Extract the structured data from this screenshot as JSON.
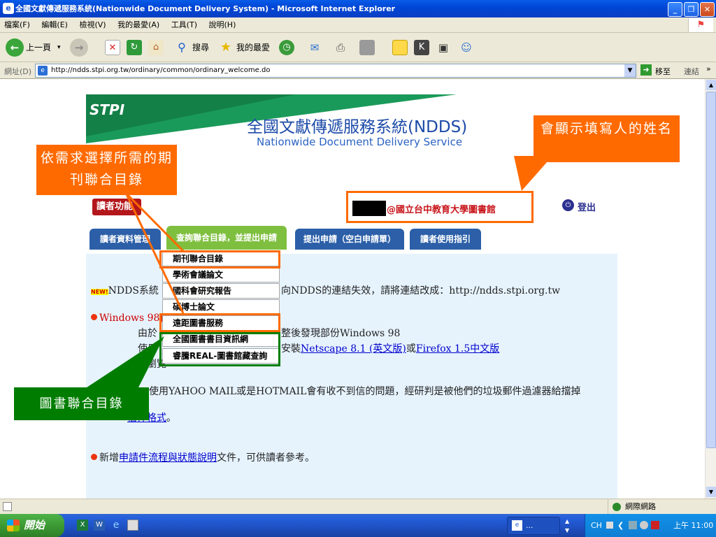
{
  "window": {
    "title": "全國文獻傳遞服務系統(Nationwide Document Delivery System) - Microsoft Internet Explorer"
  },
  "menubar": [
    "檔案(F)",
    "編輯(E)",
    "檢視(V)",
    "我的最愛(A)",
    "工具(T)",
    "說明(H)"
  ],
  "toolbar": {
    "back": "上一頁",
    "search": "搜尋",
    "favorites": "我的最愛"
  },
  "address": {
    "label": "網址(D)",
    "url": "http://ndds.stpi.org.tw/ordinary/common/ordinary_welcome.do",
    "go": "移至",
    "links": "連結"
  },
  "banner": {
    "logo": "STPI",
    "title_zh": "全國文獻傳遞服務系統(NDDS)",
    "title_en": "Nationwide Document Delivery Service"
  },
  "reader_func": "讀者功能",
  "user": {
    "org": "@國立台中教育大學圖書館"
  },
  "logout": "登出",
  "tabs": [
    "讀者資料管理",
    "查詢聯合目錄，並提出申請",
    "提出申請（空白申請單）",
    "讀者使用指引"
  ],
  "dropdown": [
    "期刊聯合目錄",
    "學術會議論文",
    "國科會研究報告",
    "碩博士論文",
    "遠距圖書服務",
    "全國圖書書目資訊網",
    "睿騰REAL-圖書館藏查詢"
  ],
  "notices": {
    "new_badge": "NEW!",
    "n1_start": "NDDS系統",
    "n1_mid": "向NDDS的連結失效，請將連結改成：",
    "n1_url": "http://ndds.stpi.org.tw",
    "n2_start": "Windows 98使",
    "n2_l2a": "由於",
    "n2_l2b": "整後發現部份Windows 98",
    "n2_l3a": "使用",
    "n2_l3b": "安裝",
    "n2_link1": "Netscape 8.1 (英文版)",
    "n2_or": "或",
    "n2_link2": "Firefox 1.5中文版",
    "n2_l4": "瀏覽",
    "n3_a": "使用YAHOO MAIL或是HOTMAIL會有收不到信的問題，經研判是被他們的垃圾郵件過濾器給擋掉",
    "n3_link": "信件格式",
    "n3_end": "。",
    "n4_a": "新增",
    "n4_link": "申請件流程與狀態說明",
    "n4_b": "文件，可供讀者參考。"
  },
  "callouts": {
    "name": "會顯示填寫人的姓名",
    "journal": "依需求選擇所需的期刊聯合目錄",
    "book": "圖書聯合目錄"
  },
  "status": {
    "zone": "網際網路"
  },
  "taskbar": {
    "start": "開始",
    "task": "...",
    "lang": "CH",
    "clock": "上午 11:00"
  },
  "colors": {
    "orange": "#ff6a00",
    "green": "#007d00",
    "tab_blue": "#2c5fa8",
    "tab_green": "#7fbf3f",
    "accent_red": "#b3161b"
  }
}
